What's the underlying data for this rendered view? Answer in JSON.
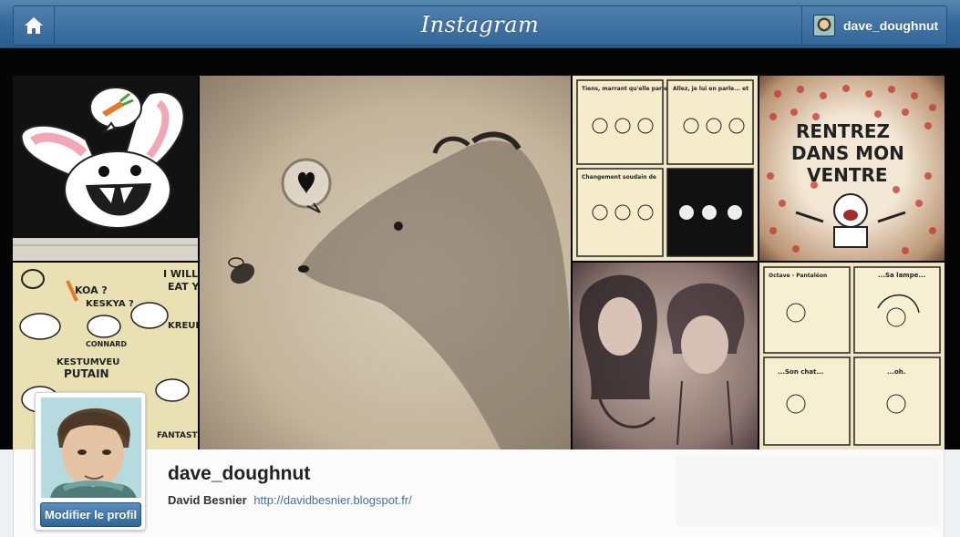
{
  "nav": {
    "logo_text": "Instagram",
    "username": "dave_doughnut"
  },
  "cover": {
    "tile_labels": {
      "bunny_bubble": "",
      "doodles": [
        "KOA ?",
        "KESKYA ?",
        "I WILL EAT YOU",
        "KREUH KREUH",
        "CONNARD",
        "KESTUMVEU PUTAIN",
        "FANTASTIQUE"
      ],
      "comic_top": [
        "Tiens, marrant qu'elle parle de ça... il m'est aussi arrivé un truc dans le genre...",
        "Allez, je lui en parle... et direct après, l'histoire de Marco qui la fera rire...",
        "Changement soudain de sujet de conversation"
      ],
      "rentrez": "RENTREZ DANS MON VENTRE",
      "comic_bottom": [
        "Octave - Pantaléon aime bien toucher du doigt...",
        "...Sa lampe...",
        "...Son chat...",
        "...oh."
      ]
    }
  },
  "profile": {
    "username": "dave_doughnut",
    "full_name": "David Besnier",
    "website": "http://davidbesnier.blogspot.fr/",
    "edit_button": "Modifier le profil"
  },
  "colors": {
    "nav_blue": "#33679b",
    "link_blue": "#3f729b",
    "button_blue": "#2f6599"
  }
}
